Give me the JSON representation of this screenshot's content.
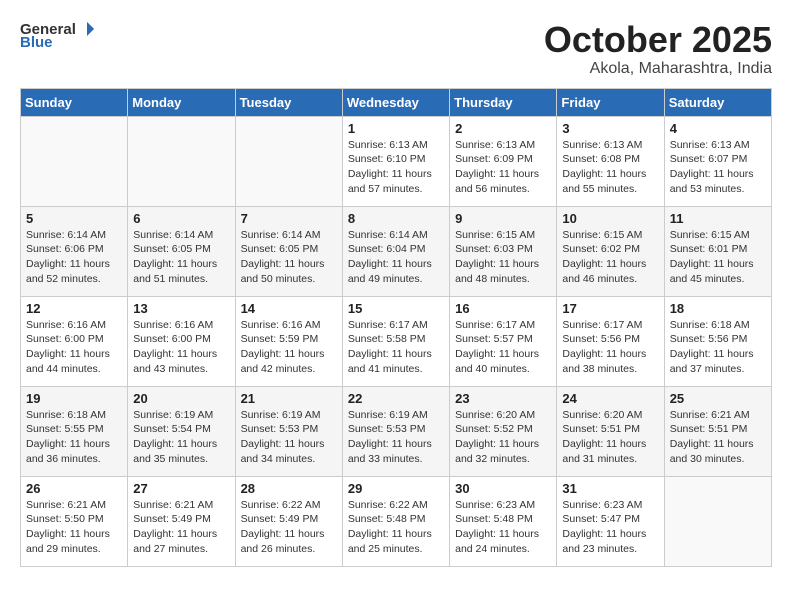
{
  "header": {
    "logo_general": "General",
    "logo_blue": "Blue",
    "month": "October 2025",
    "location": "Akola, Maharashtra, India"
  },
  "weekdays": [
    "Sunday",
    "Monday",
    "Tuesday",
    "Wednesday",
    "Thursday",
    "Friday",
    "Saturday"
  ],
  "weeks": [
    [
      {
        "day": "",
        "info": ""
      },
      {
        "day": "",
        "info": ""
      },
      {
        "day": "",
        "info": ""
      },
      {
        "day": "1",
        "info": "Sunrise: 6:13 AM\nSunset: 6:10 PM\nDaylight: 11 hours\nand 57 minutes."
      },
      {
        "day": "2",
        "info": "Sunrise: 6:13 AM\nSunset: 6:09 PM\nDaylight: 11 hours\nand 56 minutes."
      },
      {
        "day": "3",
        "info": "Sunrise: 6:13 AM\nSunset: 6:08 PM\nDaylight: 11 hours\nand 55 minutes."
      },
      {
        "day": "4",
        "info": "Sunrise: 6:13 AM\nSunset: 6:07 PM\nDaylight: 11 hours\nand 53 minutes."
      }
    ],
    [
      {
        "day": "5",
        "info": "Sunrise: 6:14 AM\nSunset: 6:06 PM\nDaylight: 11 hours\nand 52 minutes."
      },
      {
        "day": "6",
        "info": "Sunrise: 6:14 AM\nSunset: 6:05 PM\nDaylight: 11 hours\nand 51 minutes."
      },
      {
        "day": "7",
        "info": "Sunrise: 6:14 AM\nSunset: 6:05 PM\nDaylight: 11 hours\nand 50 minutes."
      },
      {
        "day": "8",
        "info": "Sunrise: 6:14 AM\nSunset: 6:04 PM\nDaylight: 11 hours\nand 49 minutes."
      },
      {
        "day": "9",
        "info": "Sunrise: 6:15 AM\nSunset: 6:03 PM\nDaylight: 11 hours\nand 48 minutes."
      },
      {
        "day": "10",
        "info": "Sunrise: 6:15 AM\nSunset: 6:02 PM\nDaylight: 11 hours\nand 46 minutes."
      },
      {
        "day": "11",
        "info": "Sunrise: 6:15 AM\nSunset: 6:01 PM\nDaylight: 11 hours\nand 45 minutes."
      }
    ],
    [
      {
        "day": "12",
        "info": "Sunrise: 6:16 AM\nSunset: 6:00 PM\nDaylight: 11 hours\nand 44 minutes."
      },
      {
        "day": "13",
        "info": "Sunrise: 6:16 AM\nSunset: 6:00 PM\nDaylight: 11 hours\nand 43 minutes."
      },
      {
        "day": "14",
        "info": "Sunrise: 6:16 AM\nSunset: 5:59 PM\nDaylight: 11 hours\nand 42 minutes."
      },
      {
        "day": "15",
        "info": "Sunrise: 6:17 AM\nSunset: 5:58 PM\nDaylight: 11 hours\nand 41 minutes."
      },
      {
        "day": "16",
        "info": "Sunrise: 6:17 AM\nSunset: 5:57 PM\nDaylight: 11 hours\nand 40 minutes."
      },
      {
        "day": "17",
        "info": "Sunrise: 6:17 AM\nSunset: 5:56 PM\nDaylight: 11 hours\nand 38 minutes."
      },
      {
        "day": "18",
        "info": "Sunrise: 6:18 AM\nSunset: 5:56 PM\nDaylight: 11 hours\nand 37 minutes."
      }
    ],
    [
      {
        "day": "19",
        "info": "Sunrise: 6:18 AM\nSunset: 5:55 PM\nDaylight: 11 hours\nand 36 minutes."
      },
      {
        "day": "20",
        "info": "Sunrise: 6:19 AM\nSunset: 5:54 PM\nDaylight: 11 hours\nand 35 minutes."
      },
      {
        "day": "21",
        "info": "Sunrise: 6:19 AM\nSunset: 5:53 PM\nDaylight: 11 hours\nand 34 minutes."
      },
      {
        "day": "22",
        "info": "Sunrise: 6:19 AM\nSunset: 5:53 PM\nDaylight: 11 hours\nand 33 minutes."
      },
      {
        "day": "23",
        "info": "Sunrise: 6:20 AM\nSunset: 5:52 PM\nDaylight: 11 hours\nand 32 minutes."
      },
      {
        "day": "24",
        "info": "Sunrise: 6:20 AM\nSunset: 5:51 PM\nDaylight: 11 hours\nand 31 minutes."
      },
      {
        "day": "25",
        "info": "Sunrise: 6:21 AM\nSunset: 5:51 PM\nDaylight: 11 hours\nand 30 minutes."
      }
    ],
    [
      {
        "day": "26",
        "info": "Sunrise: 6:21 AM\nSunset: 5:50 PM\nDaylight: 11 hours\nand 29 minutes."
      },
      {
        "day": "27",
        "info": "Sunrise: 6:21 AM\nSunset: 5:49 PM\nDaylight: 11 hours\nand 27 minutes."
      },
      {
        "day": "28",
        "info": "Sunrise: 6:22 AM\nSunset: 5:49 PM\nDaylight: 11 hours\nand 26 minutes."
      },
      {
        "day": "29",
        "info": "Sunrise: 6:22 AM\nSunset: 5:48 PM\nDaylight: 11 hours\nand 25 minutes."
      },
      {
        "day": "30",
        "info": "Sunrise: 6:23 AM\nSunset: 5:48 PM\nDaylight: 11 hours\nand 24 minutes."
      },
      {
        "day": "31",
        "info": "Sunrise: 6:23 AM\nSunset: 5:47 PM\nDaylight: 11 hours\nand 23 minutes."
      },
      {
        "day": "",
        "info": ""
      }
    ]
  ]
}
